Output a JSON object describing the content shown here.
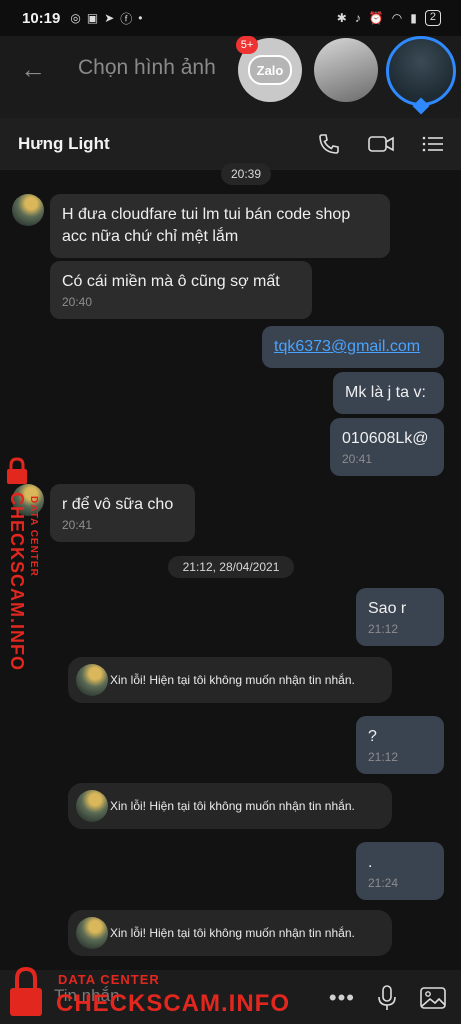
{
  "status_bar": {
    "time": "10:19",
    "battery": "2"
  },
  "share_bar": {
    "back_icon": "arrow-left-icon",
    "title": "Chọn hình ảnh",
    "zalo_label": "Zalo",
    "badge": "5+"
  },
  "header": {
    "contact_name": "Hưng Light"
  },
  "messages": {
    "time_1": "20:39",
    "in_1_text": "H đưa cloudfare tui lm tui bán code shop acc nữa chứ chỉ mệt lắm",
    "in_2_text": "Có cái miền mà ô cũng sợ mất",
    "in_2_time": "20:40",
    "out_1_text": "tqk6373@gmail.com",
    "out_2_text": "Mk là j ta v:",
    "out_3_text": "010608Lk@",
    "out_3_time": "20:41",
    "in_3_text": "r để vô sữa cho",
    "in_3_time": "20:41",
    "date_sep": "21:12, 28/04/2021",
    "out_4_text": "Sao r",
    "out_4_time": "21:12",
    "sys_1": "Xin lỗi! Hiện tại tôi không muốn nhận tin nhắn.",
    "out_5_text": "?",
    "out_5_time": "21:12",
    "sys_2": "Xin lỗi! Hiện tại tôi không muốn nhận tin nhắn.",
    "out_6_text": ".",
    "out_6_time": "21:24",
    "sys_3": "Xin lỗi! Hiện tại tôi không muốn nhận tin nhắn."
  },
  "composer": {
    "placeholder": "Tin nhắn"
  },
  "watermark": {
    "main": "CHECKSCAM.INFO",
    "sub": "DATA CENTER"
  },
  "colors": {
    "accent": "#2f89ff",
    "watermark": "#e2271f",
    "link": "#4aa3ff"
  }
}
